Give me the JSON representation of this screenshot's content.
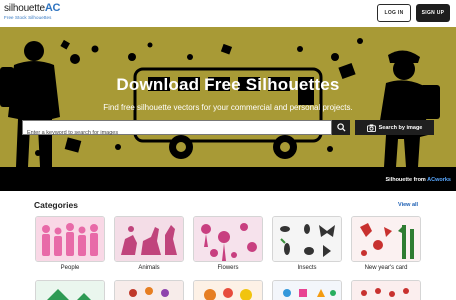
{
  "header": {
    "logo_text": "silhouette",
    "logo_accent": "AC",
    "logo_tagline": "Free Stock Silhouettes",
    "login_label": "LOG IN",
    "signup_label": "SIGN UP"
  },
  "hero": {
    "title": "Download Free Silhouettes",
    "subtitle": "Find free silhouette vectors for your commercial and personal projects.",
    "search_placeholder": "Enter a keyword to search for images",
    "search_by_image_label": "Search by image",
    "credit_prefix": "Silhouette from",
    "credit_link": "ACworks",
    "background_color": "#a89a36"
  },
  "categories": {
    "title": "Categories",
    "view_all": "View all",
    "items": [
      {
        "label": "People",
        "color": "#e86aa8"
      },
      {
        "label": "Animals",
        "color": "#c0447c"
      },
      {
        "label": "Flowers",
        "color": "#c83f80"
      },
      {
        "label": "Insects",
        "color": "#333333"
      },
      {
        "label": "New year's card",
        "color": "#c8312f"
      }
    ]
  }
}
